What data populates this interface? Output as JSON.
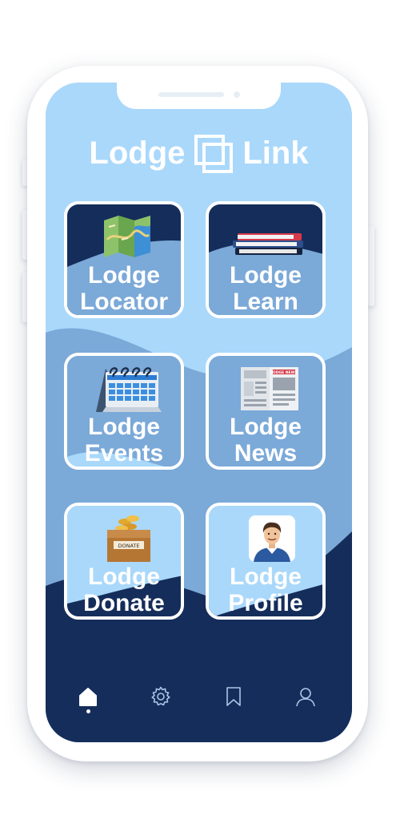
{
  "app": {
    "name_left": "Lodge",
    "name_right": "Link"
  },
  "tiles": [
    {
      "line1": "Lodge",
      "line2": "Locator",
      "icon": "folded-map-icon"
    },
    {
      "line1": "Lodge",
      "line2": "Learn",
      "icon": "books-stack-icon"
    },
    {
      "line1": "Lodge",
      "line2": "Events",
      "icon": "calendar-icon"
    },
    {
      "line1": "Lodge",
      "line2": "News",
      "icon": "newspaper-icon",
      "paper_header": "LODGE NEWS"
    },
    {
      "line1": "Lodge",
      "line2": "Donate",
      "icon": "donation-box-icon",
      "box_label": "DONATE"
    },
    {
      "line1": "Lodge",
      "line2": "Profile",
      "icon": "person-avatar-icon"
    }
  ],
  "nav": {
    "items": [
      "home-icon",
      "gear-icon",
      "bookmark-icon",
      "user-icon"
    ],
    "active": "home-icon"
  },
  "colors": {
    "light_blue": "#a9d8fb",
    "mid_blue": "#7ba9d8",
    "navy": "#152d5a",
    "white": "#ffffff"
  }
}
